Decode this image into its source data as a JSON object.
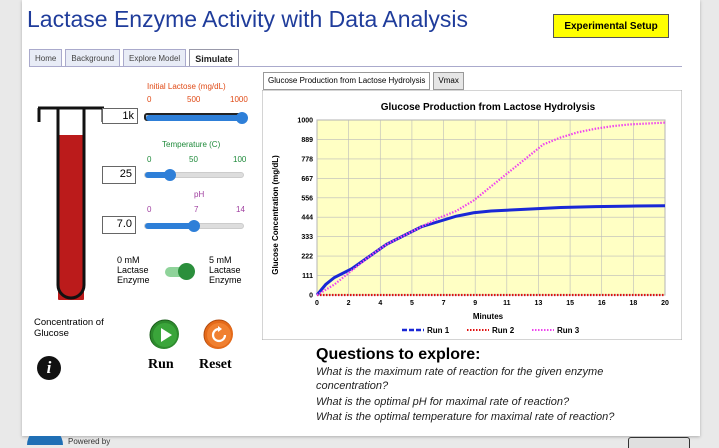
{
  "title": "Lactase Enzyme Activity with Data Analysis",
  "setup_button": "Experimental Setup",
  "tabs": [
    "Home",
    "Background",
    "Explore Model",
    "Simulate"
  ],
  "controls": {
    "lactose": {
      "label": "Initial Lactose (mg/dL)",
      "min": "0",
      "mid": "500",
      "max": "1000",
      "value": "1k",
      "fraction": 1.0
    },
    "temperature": {
      "label": "Temperature (C)",
      "min": "0",
      "mid": "50",
      "max": "100",
      "value": "25",
      "fraction": 0.25
    },
    "ph": {
      "label": "pH",
      "min": "0",
      "mid": "7",
      "max": "14",
      "value": "7.0",
      "fraction": 0.5
    },
    "enzyme": {
      "left_label": "0 mM\nLactase\nEnzyme",
      "right_label": "5 mM\nLactase\nEnzyme",
      "on": true
    }
  },
  "concentration_label": "Concentration of Glucose",
  "info_icon": "i",
  "run_label": "Run",
  "reset_label": "Reset",
  "chart_tabs": [
    "Glucose Production from Lactose Hydrolysis",
    "Vmax"
  ],
  "chart_data": {
    "type": "line",
    "title": "Glucose Production from Lactose Hydrolysis",
    "xlabel": "Minutes",
    "ylabel": "Glucose Concentration (mg/dL)",
    "xlim": [
      0,
      20
    ],
    "ylim": [
      0,
      1000
    ],
    "x_ticks": [
      "0",
      "2",
      "4",
      "5",
      "7",
      "9",
      "11",
      "13",
      "15",
      "16",
      "18",
      "20"
    ],
    "y_ticks": [
      "0",
      "111",
      "222",
      "333",
      "444",
      "556",
      "667",
      "778",
      "889",
      "1000"
    ],
    "grid": true,
    "legend": "bottom",
    "series": [
      {
        "name": "Run 1",
        "color": "#1a28d6",
        "style": "solid",
        "x": [
          0,
          0.5,
          1,
          2,
          3,
          4,
          5,
          6,
          7,
          8,
          9,
          10,
          12,
          14,
          16,
          18,
          20
        ],
        "y": [
          0,
          60,
          100,
          150,
          220,
          290,
          340,
          390,
          420,
          450,
          470,
          480,
          490,
          500,
          505,
          508,
          510
        ]
      },
      {
        "name": "Run 2",
        "color": "#e01010",
        "style": "dotted",
        "x": [
          0,
          2,
          4,
          6,
          8,
          10,
          12,
          14,
          16,
          18,
          20
        ],
        "y": [
          0,
          0,
          0,
          0,
          0,
          0,
          0,
          0,
          0,
          0,
          0
        ]
      },
      {
        "name": "Run 3",
        "color": "#ee44ee",
        "style": "dotted",
        "x": [
          0,
          1,
          2,
          3,
          4,
          5,
          6,
          7,
          8,
          9,
          10,
          11,
          12,
          13,
          14,
          15,
          16,
          17,
          18,
          19,
          20
        ],
        "y": [
          0,
          60,
          140,
          220,
          290,
          340,
          390,
          440,
          480,
          540,
          620,
          700,
          780,
          860,
          900,
          930,
          950,
          965,
          975,
          980,
          985
        ]
      }
    ]
  },
  "questions": {
    "heading": "Questions to explore:",
    "lines": [
      "What is the maximum rate of reaction for the given enzyme",
      "concentration?",
      "What is the optimal pH for maximal rate of reaction?",
      "What is the optimal temperature for maximal rate of reaction?"
    ]
  },
  "footer": "Powered by"
}
